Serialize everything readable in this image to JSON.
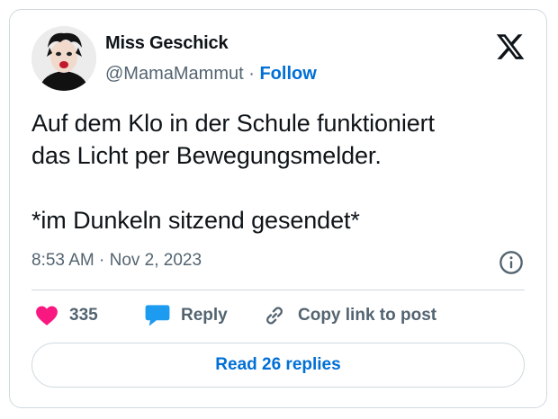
{
  "author": {
    "name": "Miss Geschick",
    "handle": "@MamaMammut",
    "separator": "·",
    "follow_label": "Follow"
  },
  "tweet": {
    "text": "Auf dem Klo in der Schule funktioniert\ndas Licht per Bewegungsmelder.\n\n*im Dunkeln sitzend gesendet*",
    "timestamp": "8:53 AM · Nov 2, 2023"
  },
  "actions": {
    "like_count": "335",
    "reply_label": "Reply",
    "copy_label": "Copy link to post"
  },
  "read_replies_label": "Read 26 replies",
  "icons": {
    "brand": "x-logo-icon",
    "info": "info-icon",
    "like": "heart-icon",
    "reply": "speech-bubble-icon",
    "copy": "link-icon"
  },
  "colors": {
    "link": "#006fd6",
    "heart": "#f91880",
    "reply_bubble": "#1d9bf0",
    "secondary_text": "#536471",
    "border": "#cfd9de"
  }
}
